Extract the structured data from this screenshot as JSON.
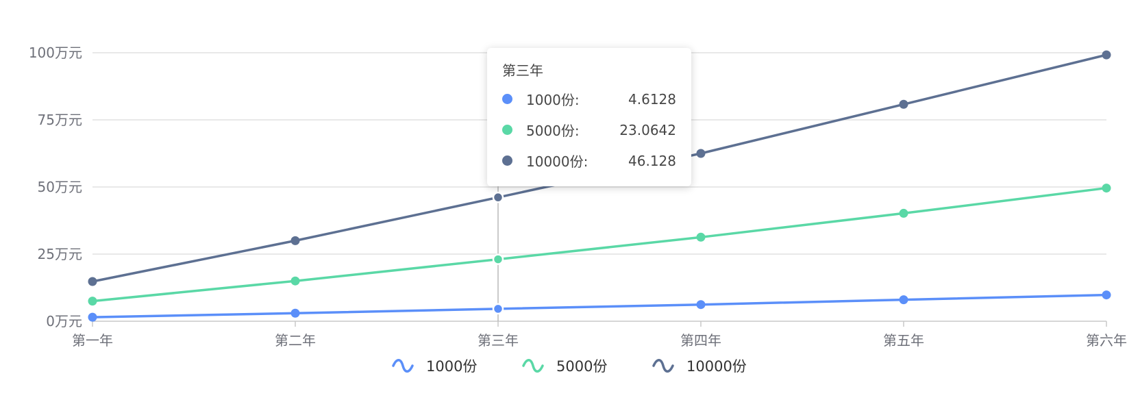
{
  "chart_data": {
    "type": "line",
    "categories": [
      "第一年",
      "第二年",
      "第三年",
      "第四年",
      "第五年",
      "第六年"
    ],
    "y_axis": {
      "min": 0,
      "max": 100,
      "ticks": [
        0,
        25,
        50,
        75,
        100
      ],
      "tick_labels": [
        "0万元",
        "25万元",
        "50万元",
        "75万元",
        "100万元"
      ]
    },
    "grid": true,
    "legend_position": "bottom",
    "series": [
      {
        "name": "1000份",
        "color": "#5b8ff9",
        "values": [
          1.5,
          3.0,
          4.6128,
          6.2,
          8.0,
          9.8
        ]
      },
      {
        "name": "5000份",
        "color": "#5ad8a6",
        "values": [
          7.5,
          15.0,
          23.0642,
          31.3,
          40.2,
          49.6
        ]
      },
      {
        "name": "10000份",
        "color": "#5d7092",
        "values": [
          14.8,
          30.0,
          46.128,
          62.5,
          80.8,
          99.2
        ]
      }
    ],
    "tooltip": {
      "category_index": 2,
      "title": "第三年",
      "rows": [
        {
          "name": "1000份:",
          "value": "4.6128",
          "color": "#5b8ff9"
        },
        {
          "name": "5000份:",
          "value": "23.0642",
          "color": "#5ad8a6"
        },
        {
          "name": "10000份:",
          "value": "46.128",
          "color": "#5d7092"
        }
      ]
    }
  }
}
